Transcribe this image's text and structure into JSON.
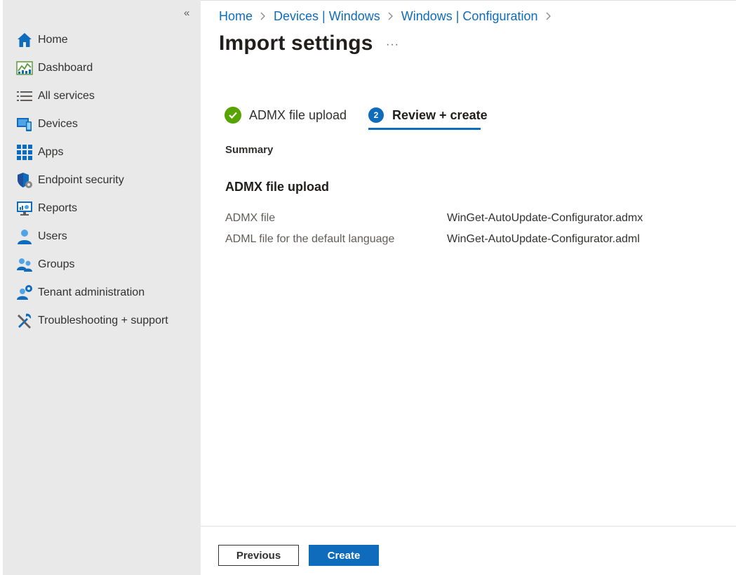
{
  "sidebar": {
    "collapse_glyph": "«",
    "items": [
      {
        "label": "Home",
        "icon": "home-icon"
      },
      {
        "label": "Dashboard",
        "icon": "dashboard-icon"
      },
      {
        "label": "All services",
        "icon": "list-icon"
      },
      {
        "label": "Devices",
        "icon": "devices-icon"
      },
      {
        "label": "Apps",
        "icon": "apps-grid-icon"
      },
      {
        "label": "Endpoint security",
        "icon": "shield-gear-icon"
      },
      {
        "label": "Reports",
        "icon": "reports-monitor-icon"
      },
      {
        "label": "Users",
        "icon": "user-icon"
      },
      {
        "label": "Groups",
        "icon": "group-icon"
      },
      {
        "label": "Tenant administration",
        "icon": "tenant-gear-icon"
      },
      {
        "label": "Troubleshooting + support",
        "icon": "tools-icon"
      }
    ]
  },
  "breadcrumb": [
    "Home",
    "Devices | Windows",
    "Windows | Configuration"
  ],
  "page": {
    "title": "Import settings",
    "more": "···"
  },
  "steps": [
    {
      "label": "ADMX file upload",
      "status": "complete"
    },
    {
      "number": "2",
      "label": "Review + create",
      "status": "active"
    }
  ],
  "summary": {
    "heading": "Summary",
    "section_title": "ADMX file upload",
    "rows": [
      {
        "label": "ADMX file",
        "value": "WinGet-AutoUpdate-Configurator.admx"
      },
      {
        "label": "ADML file for the default language",
        "value": "WinGet-AutoUpdate-Configurator.adml"
      }
    ]
  },
  "footer": {
    "previous_label": "Previous",
    "create_label": "Create"
  },
  "colors": {
    "accent": "#0f6cbd",
    "success": "#57a300",
    "sidebar_bg": "#e9e9e9"
  }
}
